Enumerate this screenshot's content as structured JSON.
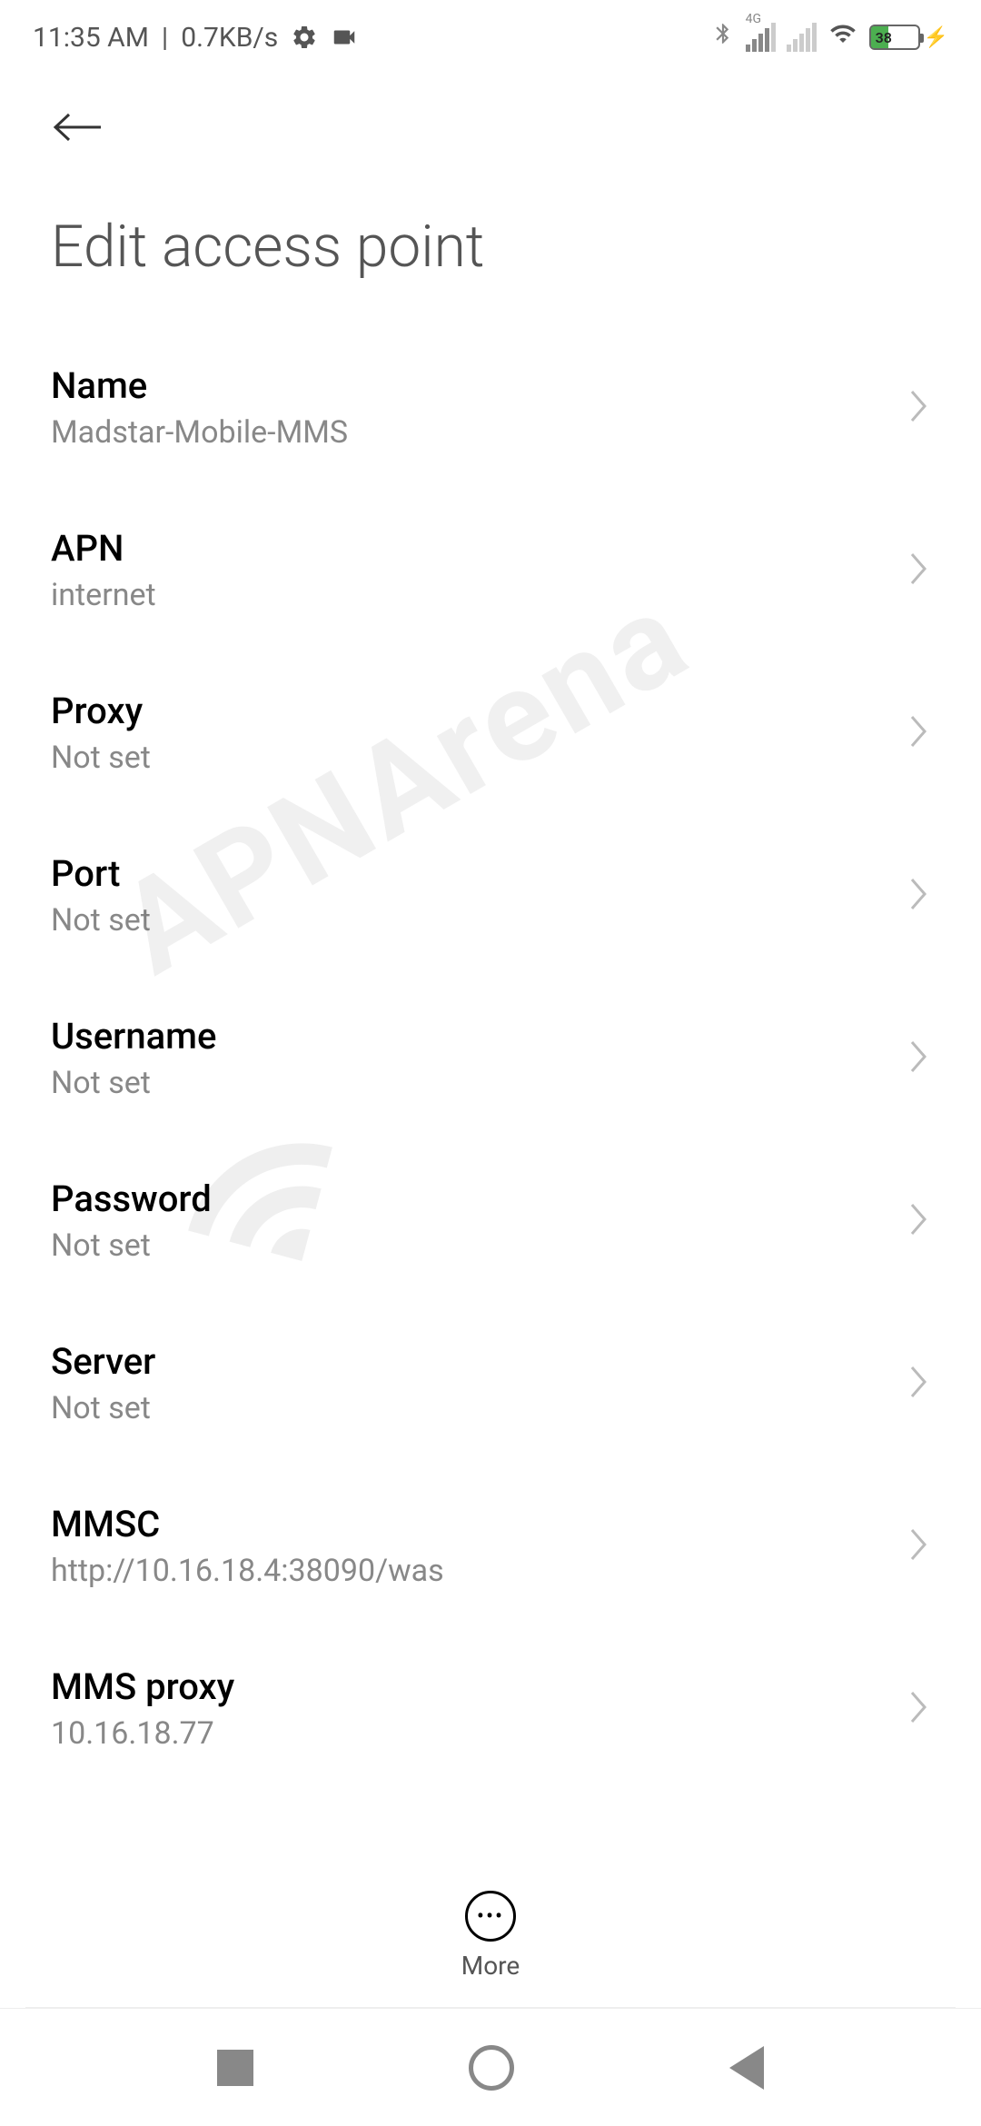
{
  "status_bar": {
    "time": "11:35 AM",
    "speed": "0.7KB/s",
    "network_type": "4G",
    "battery_percent": "38"
  },
  "page": {
    "title": "Edit access point"
  },
  "settings": [
    {
      "label": "Name",
      "value": "Madstar-Mobile-MMS"
    },
    {
      "label": "APN",
      "value": "internet"
    },
    {
      "label": "Proxy",
      "value": "Not set"
    },
    {
      "label": "Port",
      "value": "Not set"
    },
    {
      "label": "Username",
      "value": "Not set"
    },
    {
      "label": "Password",
      "value": "Not set"
    },
    {
      "label": "Server",
      "value": "Not set"
    },
    {
      "label": "MMSC",
      "value": "http://10.16.18.4:38090/was"
    },
    {
      "label": "MMS proxy",
      "value": "10.16.18.77"
    }
  ],
  "bottom": {
    "more_label": "More"
  },
  "watermark": "APNArena"
}
